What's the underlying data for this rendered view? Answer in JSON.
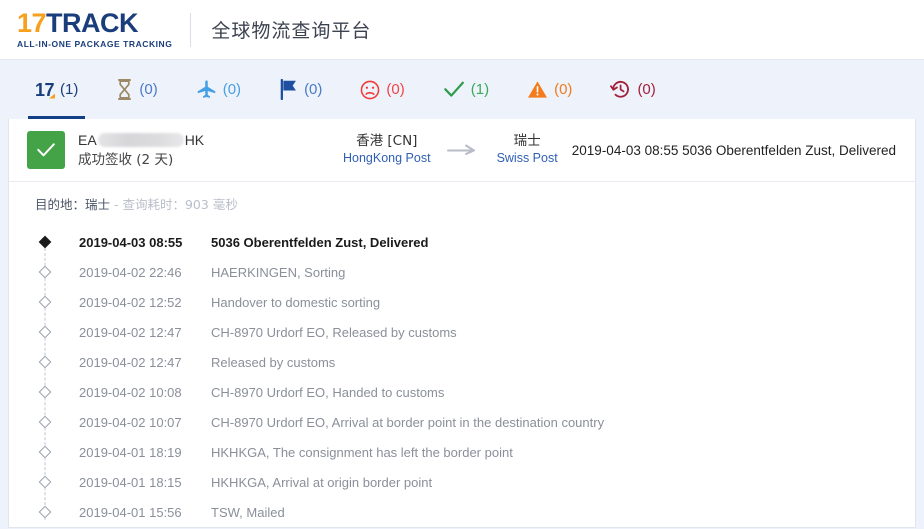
{
  "header": {
    "logo_17": "17",
    "logo_track": "TRACK",
    "logo_tagline": "ALL-IN-ONE PACKAGE TRACKING",
    "site_title": "全球物流查询平台"
  },
  "tabs": [
    {
      "icon": "17-logo-icon",
      "label": "17",
      "count": "(1)",
      "active": true,
      "count_color": "#1A3D7C"
    },
    {
      "icon": "hourglass-icon",
      "label": "",
      "count": "(0)",
      "active": false,
      "count_color": "#4a7bc8"
    },
    {
      "icon": "airplane-icon",
      "label": "",
      "count": "(0)",
      "active": false,
      "count_color": "#4a9fe0"
    },
    {
      "icon": "flag-icon",
      "label": "",
      "count": "(0)",
      "active": false,
      "count_color": "#4a7bc8"
    },
    {
      "icon": "sad-face-icon",
      "label": "",
      "count": "(0)",
      "active": false,
      "count_color": "#f04545"
    },
    {
      "icon": "checkmark-icon",
      "label": "",
      "count": "(1)",
      "active": false,
      "count_color": "#3aa95a"
    },
    {
      "icon": "warning-triangle-icon",
      "label": "",
      "count": "(0)",
      "active": false,
      "count_color": "#f07c1e"
    },
    {
      "icon": "history-clock-icon",
      "label": "",
      "count": "(0)",
      "active": false,
      "count_color": "#a31f3a"
    }
  ],
  "shipment": {
    "status_icon": "check-icon",
    "tracking_prefix": "EA",
    "tracking_suffix": "HK",
    "tracking_redacted": true,
    "status_text": "成功签收 (2 天)",
    "origin_cn": "香港 [CN]",
    "origin_en": "HongKong Post",
    "destination_cn": "瑞士",
    "destination_en": "Swiss Post",
    "latest_status": "2019-04-03 08:55  5036 Oberentfelden Zust, Delivered"
  },
  "meta": {
    "destination_label": "目的地：瑞士",
    "query_time": "- 查询耗时：903 毫秒"
  },
  "timeline": [
    {
      "date": "2019-04-03 08:55",
      "text": "5036 Oberentfelden Zust, Delivered",
      "current": true
    },
    {
      "date": "2019-04-02 22:46",
      "text": "HAERKINGEN, Sorting",
      "current": false
    },
    {
      "date": "2019-04-02 12:52",
      "text": "Handover to domestic sorting",
      "current": false
    },
    {
      "date": "2019-04-02 12:47",
      "text": "CH-8970 Urdorf EO, Released by customs",
      "current": false
    },
    {
      "date": "2019-04-02 12:47",
      "text": "Released by customs",
      "current": false
    },
    {
      "date": "2019-04-02 10:08",
      "text": "CH-8970 Urdorf EO, Handed to customs",
      "current": false
    },
    {
      "date": "2019-04-02 10:07",
      "text": "CH-8970 Urdorf EO, Arrival at border point in the destination country",
      "current": false
    },
    {
      "date": "2019-04-01 18:19",
      "text": "HKHKGA, The consignment has left the border point",
      "current": false
    },
    {
      "date": "2019-04-01 18:15",
      "text": "HKHKGA, Arrival at origin border point",
      "current": false
    },
    {
      "date": "2019-04-01 15:56",
      "text": "TSW, Mailed",
      "current": false
    }
  ],
  "colors": {
    "brand_navy": "#1A3D7C",
    "brand_orange": "#F5A11E",
    "delivered_green": "#45a347",
    "page_bg": "#eef2fa"
  }
}
